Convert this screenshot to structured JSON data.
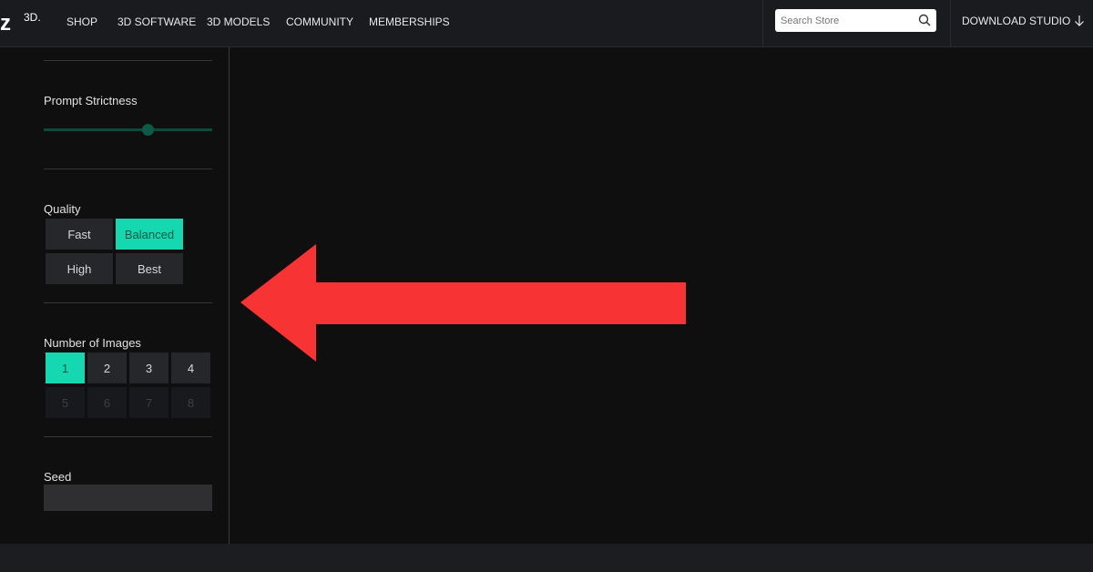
{
  "header": {
    "logo_text": "z",
    "logo_sup": "3D.",
    "nav": [
      "SHOP",
      "3D SOFTWARE",
      "3D MODELS",
      "COMMUNITY",
      "MEMBERSHIPS"
    ],
    "search_placeholder": "Search Store",
    "download_label": "DOWNLOAD STUDIO"
  },
  "sidebar": {
    "prompt_strictness": {
      "label": "Prompt Strictness",
      "value_fraction": 0.62
    },
    "quality": {
      "label": "Quality",
      "options": [
        "Fast",
        "Balanced",
        "High",
        "Best"
      ],
      "selected": "Balanced"
    },
    "number_of_images": {
      "label": "Number of Images",
      "options": [
        "1",
        "2",
        "3",
        "4",
        "5",
        "6",
        "7",
        "8"
      ],
      "selected": "1",
      "enabled_max": 4
    },
    "seed": {
      "label": "Seed",
      "value": ""
    }
  },
  "colors": {
    "accent": "#16d8b0",
    "arrow": "#f83333",
    "background": "#0f0f10",
    "topbar": "#1a1b1e"
  },
  "annotation_icon": "left-arrow-icon"
}
